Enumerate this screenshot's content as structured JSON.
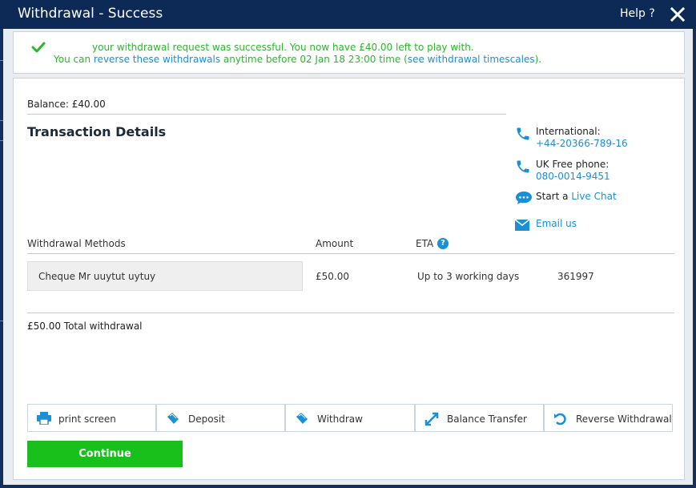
{
  "titlebar": {
    "title": "Withdrawal - Success",
    "help_label": "Help ?"
  },
  "success": {
    "line1": "your withdrawal request was successful. You now have £40.00 left to play with.",
    "line2_prefix": "You can",
    "line2_link1": "reverse these withdrawals",
    "line2_middle": "anytime before 02 Jan 18 23:00 time (",
    "line2_link2": "see withdrawal timescales",
    "line2_suffix": ")."
  },
  "balance": {
    "label": "Balance:",
    "value": "£40.00"
  },
  "transaction": {
    "title": "Transaction Details"
  },
  "contact": {
    "international_label": "International:",
    "international_number": "+44-20366-789-16",
    "uk_label": "UK Free phone:",
    "uk_number": "080-0014-9451",
    "chat_prefix": "Start a",
    "chat_link": "Live Chat",
    "email_link": "Email us"
  },
  "table": {
    "headers": {
      "method": "Withdrawal Methods",
      "amount": "Amount",
      "eta": "ETA"
    },
    "rows": [
      {
        "method": "Cheque Mr uuytut uytuy",
        "amount": "£50.00",
        "eta": "Up to 3 working days",
        "ref": "361997"
      }
    ],
    "total": "£50.00 Total withdrawal"
  },
  "actions": {
    "print": "print screen",
    "deposit": "Deposit",
    "withdraw": "Withdraw",
    "transfer": "Balance Transfer",
    "reverse": "Reverse Withdrawal"
  },
  "continue_label": "Continue",
  "colors": {
    "brand_dark": "#0d2a56",
    "link": "#1a8fd6",
    "success": "#2db52d",
    "continue": "#19c01c"
  }
}
